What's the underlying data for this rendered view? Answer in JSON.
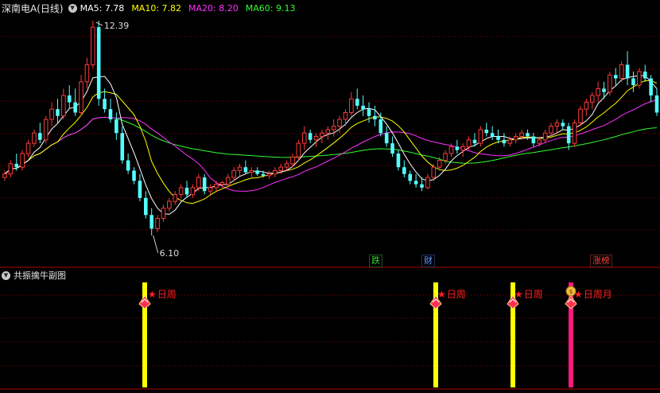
{
  "main_panel": {
    "title": "深南电A(日线)",
    "ma": [
      {
        "key": "ma5",
        "label": "MA5:",
        "value": "7.78",
        "color": "#ffffff"
      },
      {
        "key": "ma10",
        "label": "MA10:",
        "value": "7.82",
        "color": "#ffff00"
      },
      {
        "key": "ma20",
        "label": "MA20:",
        "value": "8.20",
        "color": "#ff30ff"
      },
      {
        "key": "ma60",
        "label": "MA60:",
        "value": "9.13",
        "color": "#30ff30"
      }
    ],
    "high_label": "12.39",
    "low_label": "6.10",
    "tags": [
      {
        "text": "跌",
        "color": "#30d030"
      },
      {
        "text": "财",
        "color": "#6699ff"
      },
      {
        "text": "涨榜",
        "color": "#ff4040"
      }
    ]
  },
  "sub_panel": {
    "title": "共振擒牛副图",
    "signals": [
      {
        "label": "日周",
        "bar_color": "#ffff00",
        "icon": "gem-icon"
      },
      {
        "label": "日周",
        "bar_color": "#ffff00",
        "icon": "gem-icon"
      },
      {
        "label": "日周",
        "bar_color": "#ffff00",
        "icon": "gem-icon"
      },
      {
        "label": "日周月",
        "bar_color": "#ff1a7a",
        "icon": "money-bag-gem-icon"
      }
    ]
  },
  "colors": {
    "up": "#ff3b3b",
    "down": "#54ffff",
    "grid": "#a00000",
    "bg": "#000000"
  },
  "chart_data": {
    "type": "candlestick",
    "y_range": [
      6.1,
      12.39
    ],
    "note_candles": "open/high/low/close estimated from screenshot",
    "candles": [
      [
        7.8,
        8.0,
        7.7,
        7.9
      ],
      [
        7.9,
        8.3,
        7.8,
        8.2
      ],
      [
        8.2,
        8.5,
        8.0,
        8.1
      ],
      [
        8.1,
        8.6,
        8.0,
        8.5
      ],
      [
        8.5,
        8.9,
        8.4,
        8.8
      ],
      [
        8.8,
        9.2,
        8.7,
        9.1
      ],
      [
        9.1,
        9.4,
        8.8,
        8.9
      ],
      [
        8.9,
        9.6,
        8.8,
        9.5
      ],
      [
        9.5,
        10.0,
        9.3,
        9.8
      ],
      [
        9.8,
        10.1,
        9.4,
        9.6
      ],
      [
        9.6,
        10.4,
        9.5,
        10.2
      ],
      [
        10.2,
        10.5,
        9.8,
        10.0
      ],
      [
        10.0,
        10.4,
        9.6,
        9.7
      ],
      [
        9.7,
        10.8,
        9.6,
        10.6
      ],
      [
        10.6,
        11.3,
        10.4,
        11.1
      ],
      [
        11.1,
        12.39,
        11.0,
        12.2
      ],
      [
        12.2,
        12.39,
        9.9,
        10.1
      ],
      [
        10.1,
        10.4,
        9.7,
        9.8
      ],
      [
        9.8,
        10.1,
        9.4,
        9.5
      ],
      [
        9.5,
        9.7,
        8.9,
        9.1
      ],
      [
        9.1,
        9.3,
        8.2,
        8.3
      ],
      [
        8.3,
        8.5,
        7.9,
        8.0
      ],
      [
        8.0,
        8.1,
        7.6,
        7.7
      ],
      [
        7.7,
        7.9,
        7.1,
        7.2
      ],
      [
        7.2,
        7.4,
        6.6,
        6.7
      ],
      [
        6.7,
        6.9,
        6.1,
        6.3
      ],
      [
        6.3,
        6.7,
        6.2,
        6.6
      ],
      [
        6.6,
        7.0,
        6.5,
        6.9
      ],
      [
        6.9,
        7.2,
        6.8,
        7.1
      ],
      [
        7.1,
        7.4,
        7.0,
        7.3
      ],
      [
        7.3,
        7.6,
        7.2,
        7.5
      ],
      [
        7.5,
        7.7,
        7.2,
        7.3
      ],
      [
        7.3,
        7.6,
        7.2,
        7.5
      ],
      [
        7.5,
        7.9,
        7.4,
        7.8
      ],
      [
        7.8,
        7.9,
        7.3,
        7.4
      ],
      [
        7.4,
        7.6,
        7.3,
        7.5
      ],
      [
        7.5,
        7.7,
        7.4,
        7.6
      ],
      [
        7.6,
        7.7,
        7.5,
        7.65
      ],
      [
        7.6,
        7.9,
        7.5,
        7.8
      ],
      [
        7.8,
        8.1,
        7.7,
        8.0
      ],
      [
        8.0,
        8.2,
        7.8,
        8.1
      ],
      [
        8.1,
        8.3,
        7.9,
        7.95
      ],
      [
        7.95,
        8.1,
        7.8,
        8.0
      ],
      [
        8.0,
        8.1,
        7.85,
        7.9
      ],
      [
        7.9,
        8.0,
        7.8,
        7.85
      ],
      [
        7.85,
        8.0,
        7.75,
        7.9
      ],
      [
        7.9,
        8.1,
        7.8,
        8.0
      ],
      [
        8.0,
        8.2,
        7.9,
        8.1
      ],
      [
        8.1,
        8.3,
        8.0,
        8.2
      ],
      [
        8.2,
        8.5,
        8.1,
        8.4
      ],
      [
        8.4,
        8.9,
        8.3,
        8.8
      ],
      [
        8.8,
        9.3,
        8.6,
        9.1
      ],
      [
        9.1,
        9.2,
        8.8,
        8.9
      ],
      [
        8.9,
        9.1,
        8.7,
        9.0
      ],
      [
        9.0,
        9.2,
        8.8,
        9.1
      ],
      [
        9.1,
        9.3,
        8.9,
        9.2
      ],
      [
        9.2,
        9.5,
        9.0,
        9.3
      ],
      [
        9.3,
        9.6,
        9.1,
        9.5
      ],
      [
        9.5,
        9.8,
        9.3,
        9.7
      ],
      [
        9.7,
        10.3,
        9.6,
        10.1
      ],
      [
        10.1,
        10.4,
        9.8,
        9.9
      ],
      [
        9.9,
        10.2,
        9.6,
        9.8
      ],
      [
        9.8,
        10.0,
        9.4,
        9.6
      ],
      [
        9.6,
        9.9,
        9.3,
        9.5
      ],
      [
        9.5,
        9.7,
        9.0,
        9.1
      ],
      [
        9.1,
        9.3,
        8.7,
        8.8
      ],
      [
        8.8,
        9.0,
        8.4,
        8.5
      ],
      [
        8.5,
        8.6,
        8.0,
        8.1
      ],
      [
        8.1,
        8.3,
        7.8,
        7.9
      ],
      [
        7.9,
        8.0,
        7.6,
        7.7
      ],
      [
        7.7,
        7.9,
        7.5,
        7.6
      ],
      [
        7.6,
        7.8,
        7.4,
        7.5
      ],
      [
        7.5,
        7.9,
        7.45,
        7.8
      ],
      [
        7.8,
        8.2,
        7.7,
        8.1
      ],
      [
        8.1,
        8.4,
        8.0,
        8.3
      ],
      [
        8.3,
        8.6,
        8.2,
        8.5
      ],
      [
        8.5,
        8.8,
        8.4,
        8.7
      ],
      [
        8.7,
        8.9,
        8.5,
        8.6
      ],
      [
        8.6,
        8.8,
        8.4,
        8.7
      ],
      [
        8.7,
        9.0,
        8.6,
        8.9
      ],
      [
        8.9,
        9.1,
        8.7,
        8.8
      ],
      [
        8.8,
        9.3,
        8.7,
        9.2
      ],
      [
        9.2,
        9.4,
        9.0,
        9.1
      ],
      [
        9.1,
        9.3,
        8.9,
        9.0
      ],
      [
        9.0,
        9.2,
        8.8,
        8.9
      ],
      [
        8.9,
        9.1,
        8.7,
        8.8
      ],
      [
        8.8,
        9.0,
        8.7,
        8.9
      ],
      [
        8.9,
        9.1,
        8.8,
        9.0
      ],
      [
        9.0,
        9.2,
        8.9,
        9.1
      ],
      [
        9.1,
        9.2,
        8.9,
        9.0
      ],
      [
        9.0,
        9.1,
        8.7,
        8.8
      ],
      [
        8.8,
        9.0,
        8.7,
        8.9
      ],
      [
        8.9,
        9.2,
        8.8,
        9.1
      ],
      [
        9.1,
        9.4,
        9.0,
        9.3
      ],
      [
        9.3,
        9.5,
        9.1,
        9.4
      ],
      [
        9.4,
        9.5,
        9.2,
        9.3
      ],
      [
        9.3,
        9.4,
        8.6,
        8.8
      ],
      [
        8.8,
        9.5,
        8.7,
        9.4
      ],
      [
        9.4,
        9.9,
        9.3,
        9.8
      ],
      [
        9.8,
        10.1,
        9.6,
        10.0
      ],
      [
        10.0,
        10.3,
        9.8,
        10.2
      ],
      [
        10.2,
        10.6,
        10.0,
        10.4
      ],
      [
        10.4,
        10.6,
        10.1,
        10.3
      ],
      [
        10.3,
        10.9,
        10.2,
        10.8
      ],
      [
        10.8,
        11.0,
        10.5,
        10.7
      ],
      [
        10.7,
        11.2,
        10.6,
        11.1
      ],
      [
        11.1,
        11.5,
        10.5,
        10.7
      ],
      [
        10.7,
        10.9,
        10.3,
        10.5
      ],
      [
        10.5,
        11.0,
        10.4,
        10.9
      ],
      [
        10.9,
        11.1,
        10.6,
        10.7
      ],
      [
        10.7,
        10.8,
        10.0,
        10.2
      ],
      [
        10.2,
        10.4,
        9.6,
        9.7
      ]
    ]
  }
}
